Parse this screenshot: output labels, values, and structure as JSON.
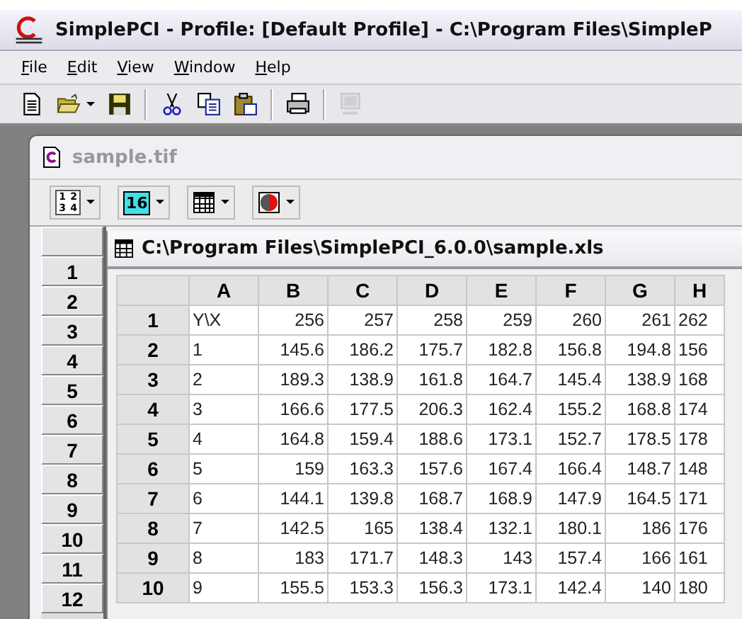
{
  "window": {
    "title": "SimplePCI - Profile: [Default Profile] - C:\\Program Files\\SimpleP"
  },
  "menu": [
    {
      "label": "File"
    },
    {
      "label": "Edit"
    },
    {
      "label": "View"
    },
    {
      "label": "Window"
    },
    {
      "label": "Help"
    }
  ],
  "toolbar": [
    {
      "kind": "new",
      "disabled": false
    },
    {
      "kind": "open",
      "disabled": false
    },
    {
      "kind": "caret",
      "disabled": false
    },
    {
      "kind": "save",
      "disabled": false
    },
    {
      "kind": "sep",
      "disabled": false
    },
    {
      "kind": "cut",
      "disabled": false
    },
    {
      "kind": "copy",
      "disabled": false
    },
    {
      "kind": "paste",
      "disabled": false
    },
    {
      "kind": "sep",
      "disabled": false
    },
    {
      "kind": "print",
      "disabled": false
    },
    {
      "kind": "sep",
      "disabled": false
    },
    {
      "kind": "monitor",
      "disabled": true
    }
  ],
  "child_window": {
    "title": "sample.tif",
    "toolbar": [
      {
        "kind": "grid",
        "digits": [
          "1",
          "2",
          "3",
          "4"
        ]
      },
      {
        "kind": "number",
        "text": "16"
      },
      {
        "kind": "table"
      },
      {
        "kind": "color"
      }
    ],
    "side_rows": [
      "1",
      "2",
      "3",
      "4",
      "5",
      "6",
      "7",
      "8",
      "9",
      "10",
      "11",
      "12"
    ]
  },
  "sheet": {
    "title": "C:\\Program Files\\SimplePCI_6.0.0\\sample.xls",
    "columns": [
      "A",
      "B",
      "C",
      "D",
      "E",
      "F",
      "G",
      "H"
    ],
    "rows": [
      {
        "header": "1",
        "cells": [
          "Y\\X",
          "256",
          "257",
          "258",
          "259",
          "260",
          "261",
          "262"
        ]
      },
      {
        "header": "2",
        "cells": [
          "1",
          "145.6",
          "186.2",
          "175.7",
          "182.8",
          "156.8",
          "194.8",
          "156"
        ]
      },
      {
        "header": "3",
        "cells": [
          "2",
          "189.3",
          "138.9",
          "161.8",
          "164.7",
          "145.4",
          "138.9",
          "168"
        ]
      },
      {
        "header": "4",
        "cells": [
          "3",
          "166.6",
          "177.5",
          "206.3",
          "162.4",
          "155.2",
          "168.8",
          "174"
        ]
      },
      {
        "header": "5",
        "cells": [
          "4",
          "164.8",
          "159.4",
          "188.6",
          "173.1",
          "152.7",
          "178.5",
          "178"
        ]
      },
      {
        "header": "6",
        "cells": [
          "5",
          "159",
          "163.3",
          "157.6",
          "167.4",
          "166.4",
          "148.7",
          "148"
        ]
      },
      {
        "header": "7",
        "cells": [
          "6",
          "144.1",
          "139.8",
          "168.7",
          "168.9",
          "147.9",
          "164.5",
          "171"
        ]
      },
      {
        "header": "8",
        "cells": [
          "7",
          "142.5",
          "165",
          "138.4",
          "132.1",
          "180.1",
          "186",
          "176"
        ]
      },
      {
        "header": "9",
        "cells": [
          "8",
          "183",
          "171.7",
          "148.3",
          "143",
          "157.4",
          "166",
          "161"
        ]
      },
      {
        "header": "10",
        "cells": [
          "9",
          "155.5",
          "153.3",
          "156.3",
          "173.1",
          "142.4",
          "140",
          "180"
        ]
      }
    ]
  }
}
